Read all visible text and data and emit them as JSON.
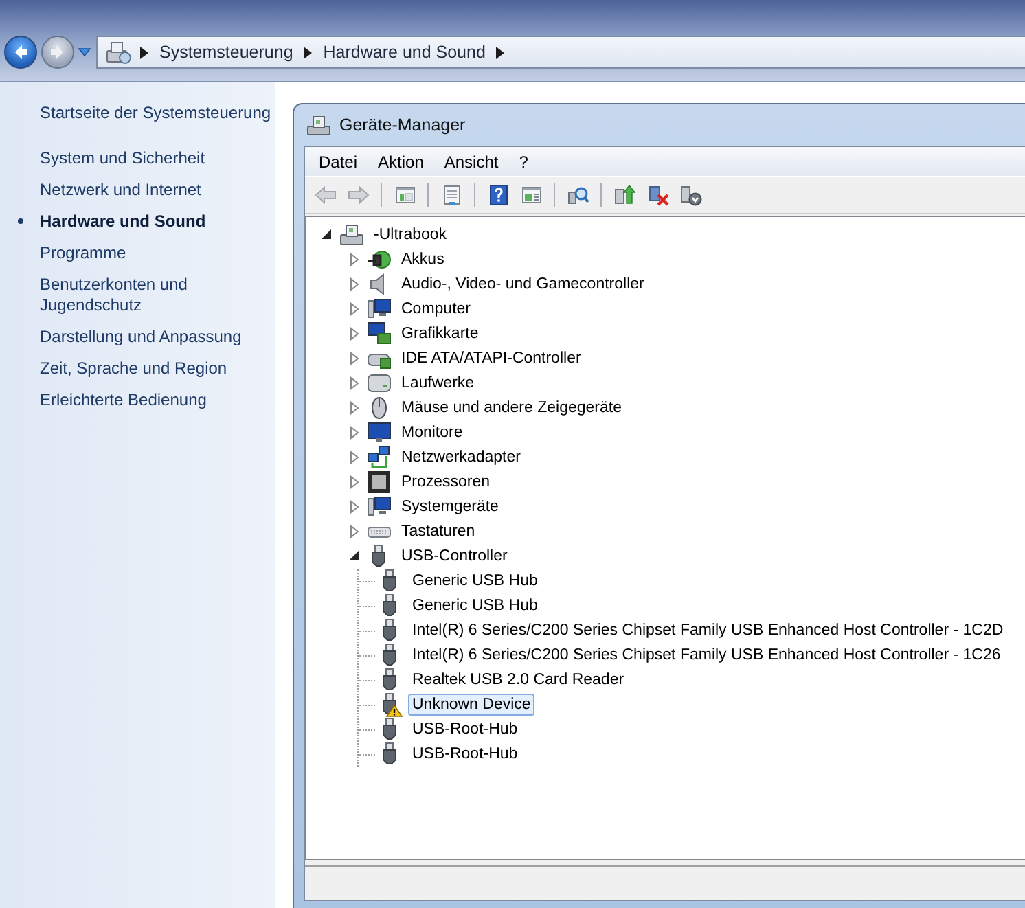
{
  "nav_buttons": [
    {
      "kind": "back",
      "disabled": false
    },
    {
      "kind": "forward",
      "disabled": true
    }
  ],
  "address_bar": {
    "crumbs": [
      "Systemsteuerung",
      "Hardware und Sound"
    ]
  },
  "sidebar": {
    "home_link": "Startseite der Systemsteuerung",
    "items": [
      {
        "label": "System und Sicherheit",
        "selected": false
      },
      {
        "label": "Netzwerk und Internet",
        "selected": false
      },
      {
        "label": "Hardware und Sound",
        "selected": true
      },
      {
        "label": "Programme",
        "selected": false
      },
      {
        "label": "Benutzerkonten und Jugendschutz",
        "selected": false
      },
      {
        "label": "Darstellung und Anpassung",
        "selected": false
      },
      {
        "label": "Zeit, Sprache und Region",
        "selected": false
      },
      {
        "label": "Erleichterte Bedienung",
        "selected": false
      }
    ]
  },
  "window": {
    "title": "Geräte-Manager",
    "menu": [
      "Datei",
      "Aktion",
      "Ansicht",
      "?"
    ],
    "toolbar": [
      {
        "kind": "back",
        "disabled": true
      },
      {
        "kind": "forward",
        "disabled": true
      },
      {
        "kind": "separator"
      },
      {
        "kind": "console-tree",
        "disabled": false
      },
      {
        "kind": "separator"
      },
      {
        "kind": "properties",
        "disabled": false
      },
      {
        "kind": "separator"
      },
      {
        "kind": "help",
        "disabled": false
      },
      {
        "kind": "action-pane",
        "disabled": false
      },
      {
        "kind": "separator"
      },
      {
        "kind": "scan",
        "disabled": false
      },
      {
        "kind": "separator"
      },
      {
        "kind": "update",
        "disabled": false
      },
      {
        "kind": "disable",
        "disabled": false
      },
      {
        "kind": "uninstall",
        "disabled": false
      }
    ],
    "tree": [
      {
        "label": "-Ultrabook",
        "kind": "root",
        "expanded": true,
        "selected": false,
        "children": [
          {
            "label": "Akkus",
            "kind": "battery",
            "expanded": false,
            "selected": false
          },
          {
            "label": "Audio-, Video- und Gamecontroller",
            "kind": "speaker",
            "expanded": false,
            "selected": false
          },
          {
            "label": "Computer",
            "kind": "computer",
            "expanded": false,
            "selected": false
          },
          {
            "label": "Grafikkarte",
            "kind": "display-adapter",
            "expanded": false,
            "selected": false
          },
          {
            "label": "IDE ATA/ATAPI-Controller",
            "kind": "controller",
            "expanded": false,
            "selected": false
          },
          {
            "label": "Laufwerke",
            "kind": "drive",
            "expanded": false,
            "selected": false
          },
          {
            "label": "Mäuse und andere Zeigegeräte",
            "kind": "mouse",
            "expanded": false,
            "selected": false
          },
          {
            "label": "Monitore",
            "kind": "monitor",
            "expanded": false,
            "selected": false
          },
          {
            "label": "Netzwerkadapter",
            "kind": "network",
            "expanded": false,
            "selected": false
          },
          {
            "label": "Prozessoren",
            "kind": "processor",
            "expanded": false,
            "selected": false
          },
          {
            "label": "Systemgeräte",
            "kind": "computer",
            "expanded": false,
            "selected": false
          },
          {
            "label": "Tastaturen",
            "kind": "keyboard",
            "expanded": false,
            "selected": false
          },
          {
            "label": "USB-Controller",
            "kind": "usb",
            "expanded": true,
            "selected": false,
            "children": [
              {
                "label": "Generic USB Hub",
                "kind": "usb",
                "selected": false,
                "warning": false
              },
              {
                "label": "Generic USB Hub",
                "kind": "usb",
                "selected": false,
                "warning": false
              },
              {
                "label": "Intel(R) 6 Series/C200 Series Chipset Family USB Enhanced Host Controller - 1C2D",
                "kind": "usb",
                "selected": false,
                "warning": false
              },
              {
                "label": "Intel(R) 6 Series/C200 Series Chipset Family USB Enhanced Host Controller - 1C26",
                "kind": "usb",
                "selected": false,
                "warning": false
              },
              {
                "label": "Realtek USB 2.0 Card Reader",
                "kind": "usb",
                "selected": false,
                "warning": false
              },
              {
                "label": "Unknown Device",
                "kind": "usb",
                "selected": true,
                "warning": true
              },
              {
                "label": "USB-Root-Hub",
                "kind": "usb",
                "selected": false,
                "warning": false
              },
              {
                "label": "USB-Root-Hub",
                "kind": "usb",
                "selected": false,
                "warning": false
              }
            ]
          }
        ]
      }
    ]
  }
}
